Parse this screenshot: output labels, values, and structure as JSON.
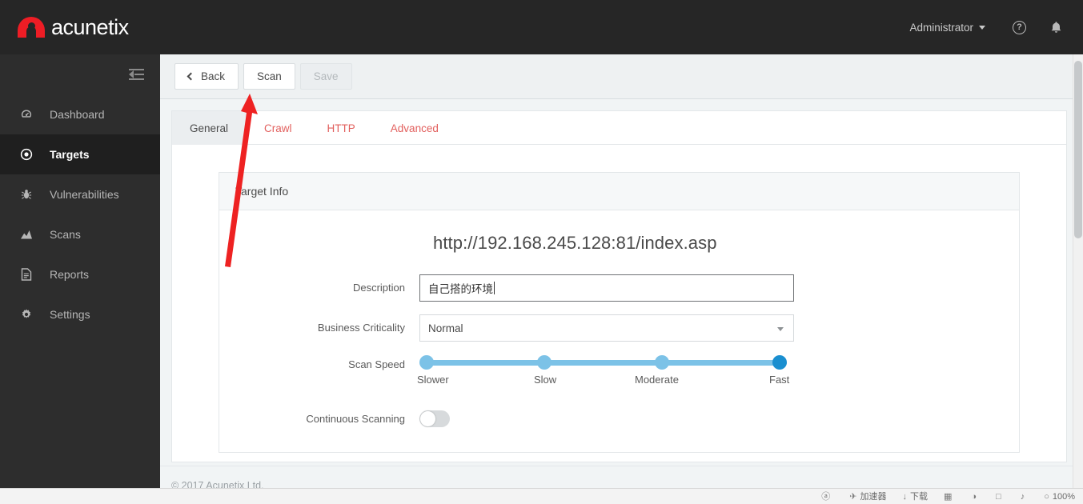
{
  "app": {
    "brand": "acunetix",
    "brand_color": "#ee1d25",
    "accent_red": "#e2605e",
    "slider_color": "#7cc2e7",
    "slider_selected_color": "#1a8fd0"
  },
  "header": {
    "user_label": "Administrator",
    "help_icon": "help-circle-icon",
    "help_glyph": "?",
    "bell_icon": "notification-bell-icon",
    "bell_glyph": "✉",
    "caret_icon": "chevron-down-icon"
  },
  "sidebar": {
    "collapse_icon": "collapse-sidebar-icon",
    "items": [
      {
        "label": "Dashboard",
        "icon": "dashboard-gauge-icon",
        "glyph": "◔",
        "active": false
      },
      {
        "label": "Targets",
        "icon": "target-bullseye-icon",
        "glyph": "◎",
        "active": true
      },
      {
        "label": "Vulnerabilities",
        "icon": "bug-icon",
        "glyph": "☣",
        "active": false
      },
      {
        "label": "Scans",
        "icon": "chart-area-icon",
        "glyph": "◢",
        "active": false
      },
      {
        "label": "Reports",
        "icon": "document-report-icon",
        "glyph": "▤",
        "active": false
      },
      {
        "label": "Settings",
        "icon": "gear-icon",
        "glyph": "⚙",
        "active": false
      }
    ]
  },
  "toolbar": {
    "back_label": "Back",
    "back_icon": "chevron-left-icon",
    "scan_label": "Scan",
    "save_label": "Save",
    "save_disabled": true
  },
  "tabs": [
    {
      "label": "General",
      "active": true
    },
    {
      "label": "Crawl",
      "active": false
    },
    {
      "label": "HTTP",
      "active": false
    },
    {
      "label": "Advanced",
      "active": false
    }
  ],
  "main": {
    "section_title": "Target Info",
    "target_url": "http://192.168.245.128:81/index.asp",
    "fields": {
      "description": {
        "label": "Description",
        "value": "自己搭的环境",
        "placeholder": ""
      },
      "business_criticality": {
        "label": "Business Criticality",
        "value": "Normal",
        "options": [
          "Normal"
        ],
        "caret_icon": "chevron-down-icon"
      },
      "scan_speed": {
        "label": "Scan Speed",
        "stops": [
          "Slower",
          "Slow",
          "Moderate",
          "Fast"
        ],
        "selected_index": 3
      },
      "continuous_scanning": {
        "label": "Continuous Scanning",
        "enabled": false
      }
    }
  },
  "footer": {
    "copyright": "© 2017 Acunetix Ltd."
  },
  "browser_status": {
    "items": [
      {
        "glyph": "ⓐ",
        "label": ""
      },
      {
        "glyph": "✈",
        "label": "加速器"
      },
      {
        "glyph": "↓",
        "label": "下载"
      },
      {
        "glyph": "▦",
        "label": ""
      },
      {
        "glyph": "◑",
        "label": ""
      },
      {
        "glyph": "□",
        "label": ""
      },
      {
        "glyph": "♪",
        "label": ""
      },
      {
        "glyph": "○",
        "label": "100%"
      }
    ]
  }
}
